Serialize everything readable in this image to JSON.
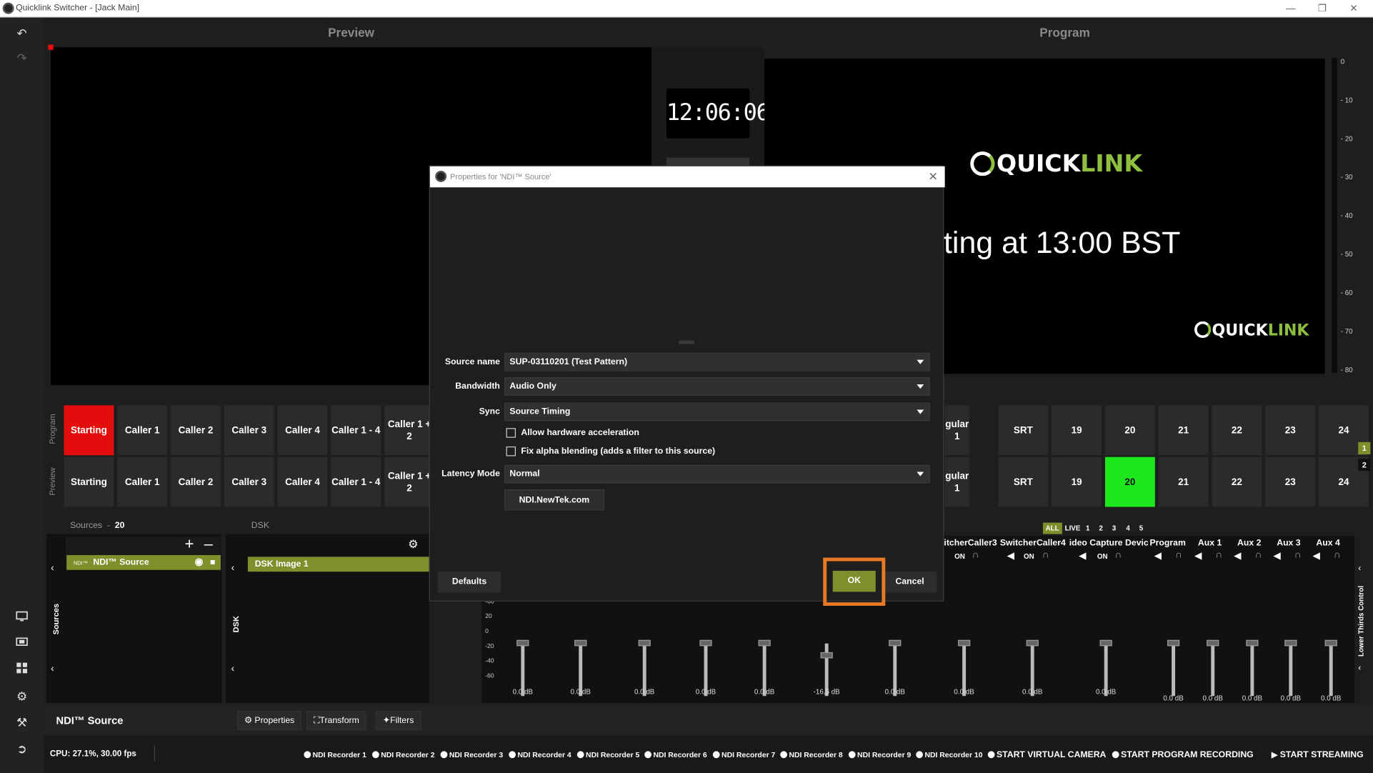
{
  "window": {
    "title": "Quicklink Switcher - [Jack Main]"
  },
  "panes": {
    "preview": "Preview",
    "program": "Program"
  },
  "clock": "12:06:06",
  "program_screen": {
    "logo_quick": "QUICK",
    "logo_link": "LINK",
    "text": "rting at 13:00 BST"
  },
  "meter": {
    "ticks": [
      "0",
      "- 10",
      "- 20",
      "- 30",
      "- 40",
      "- 50",
      "- 60",
      "- 70",
      "- 80"
    ]
  },
  "program_row": {
    "label": "Program",
    "tiles": [
      "Starting",
      "Caller 1",
      "Caller 2",
      "Caller 3",
      "Caller 4",
      "Caller 1 - 4",
      "Caller 1 + 2"
    ],
    "right_tiles": [
      "gular 1",
      "SRT",
      "19",
      "20",
      "21",
      "22",
      "23",
      "24"
    ]
  },
  "preview_row": {
    "label": "Preview",
    "tiles": [
      "Starting",
      "Caller 1",
      "Caller 2",
      "Caller 3",
      "Caller 4",
      "Caller 1 - 4",
      "Caller 1 + 2"
    ],
    "right_tiles": [
      "gular 1",
      "SRT",
      "19",
      "20",
      "21",
      "22",
      "23",
      "24"
    ]
  },
  "side_numbers": [
    "1",
    "2"
  ],
  "sources": {
    "header": "Sources",
    "count": "20",
    "side_label": "Sources",
    "item": "NDI™ Source",
    "item_badge": "NDI™"
  },
  "dsk": {
    "header": "DSK",
    "side_label": "DSK",
    "item": "DSK Image 1"
  },
  "mixer": {
    "filters": [
      "ALL",
      "LIVE",
      "1",
      "2",
      "3",
      "4",
      "5"
    ],
    "channels": [
      "itcherCaller3",
      "SwitcherCaller4",
      "ideo Capture Devic",
      "Program",
      "Aux 1",
      "Aux 2",
      "Aux 3",
      "Aux 4"
    ],
    "on_label": "ON",
    "scale": [
      "-60",
      "20",
      "0",
      "-20",
      "-40",
      "-60"
    ],
    "db_values": [
      "0.0 dB",
      "0.0 dB",
      "0.0 dB",
      "0.0 dB",
      "0.0 dB",
      "-16.5 dB",
      "0.0 dB",
      "0.0 dB",
      "0.0 dB",
      "0.0 dB"
    ],
    "right_db": [
      "0.0 dB",
      "0.0 dB",
      "0.0 dB",
      "0.0 dB",
      "0.0 dB"
    ],
    "side_label": "Lower Thirds Control"
  },
  "selected_source": "NDI™ Source",
  "toolbar": {
    "properties": "Properties",
    "transform": "Transform",
    "filters": "Filters"
  },
  "status": {
    "cpu": "CPU: 27.1%, 30.00 fps",
    "recorders": [
      "NDI Recorder 1",
      "NDI Recorder 2",
      "NDI Recorder 3",
      "NDI Recorder 4",
      "NDI Recorder 5",
      "NDI Recorder 6",
      "NDI Recorder 7",
      "NDI Recorder 8",
      "NDI Recorder 9",
      "NDI Recorder 10"
    ],
    "virtual_camera": "START VIRTUAL CAMERA",
    "program_recording": "START PROGRAM RECORDING",
    "streaming": "START STREAMING"
  },
  "dialog": {
    "title": "Properties for 'NDI™ Source'",
    "source_name_label": "Source name",
    "source_name_value": "SUP-03110201 (Test Pattern)",
    "bandwidth_label": "Bandwidth",
    "bandwidth_value": "Audio Only",
    "sync_label": "Sync",
    "sync_value": "Source Timing",
    "hw_accel": "Allow hardware acceleration",
    "alpha_fix": "Fix alpha blending (adds a filter to this source)",
    "latency_label": "Latency Mode",
    "latency_value": "Normal",
    "ndi_link": "NDI.NewTek.com",
    "defaults": "Defaults",
    "ok": "OK",
    "cancel": "Cancel"
  },
  "colors": {
    "accent": "#7f8f2c",
    "live_red": "#e40d0d",
    "preview_green": "#1ce61c",
    "highlight": "#e87a25"
  }
}
